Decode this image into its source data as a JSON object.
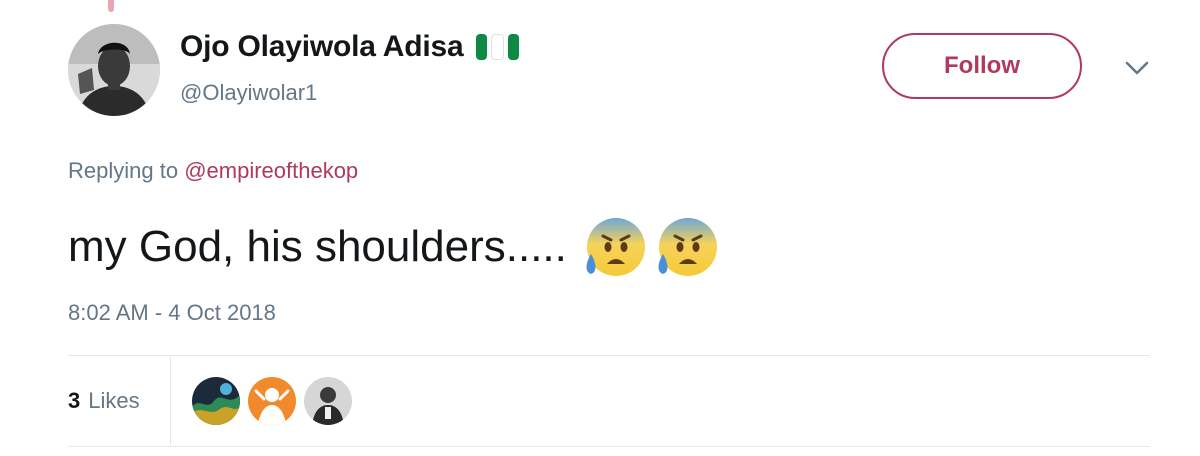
{
  "author": {
    "display_name": "Ojo Olayiwola Adisa",
    "handle": "@Olayiwolar1",
    "flag_icon": "nigeria-flag-icon",
    "flag_colors": [
      "#0c8a43",
      "#ffffff",
      "#0c8a43"
    ]
  },
  "actions": {
    "follow_label": "Follow",
    "more_icon": "chevron-down-icon"
  },
  "reply": {
    "prefix": "Replying to ",
    "mention": "@empireofthekop"
  },
  "tweet": {
    "text": "my God, his shoulders.....",
    "emojis": [
      "anxious-face-with-sweat-icon",
      "anxious-face-with-sweat-icon"
    ],
    "timestamp": "8:02 AM - 4 Oct 2018"
  },
  "engagement": {
    "likes_count": "3",
    "likes_label": "Likes",
    "liker_avatars": [
      "liker-avatar-1",
      "liker-avatar-2",
      "liker-avatar-3"
    ]
  },
  "colors": {
    "accent": "#b03a5b",
    "secondary_text": "#657786",
    "primary_text": "#14171a",
    "divider": "#e1e8ed"
  }
}
